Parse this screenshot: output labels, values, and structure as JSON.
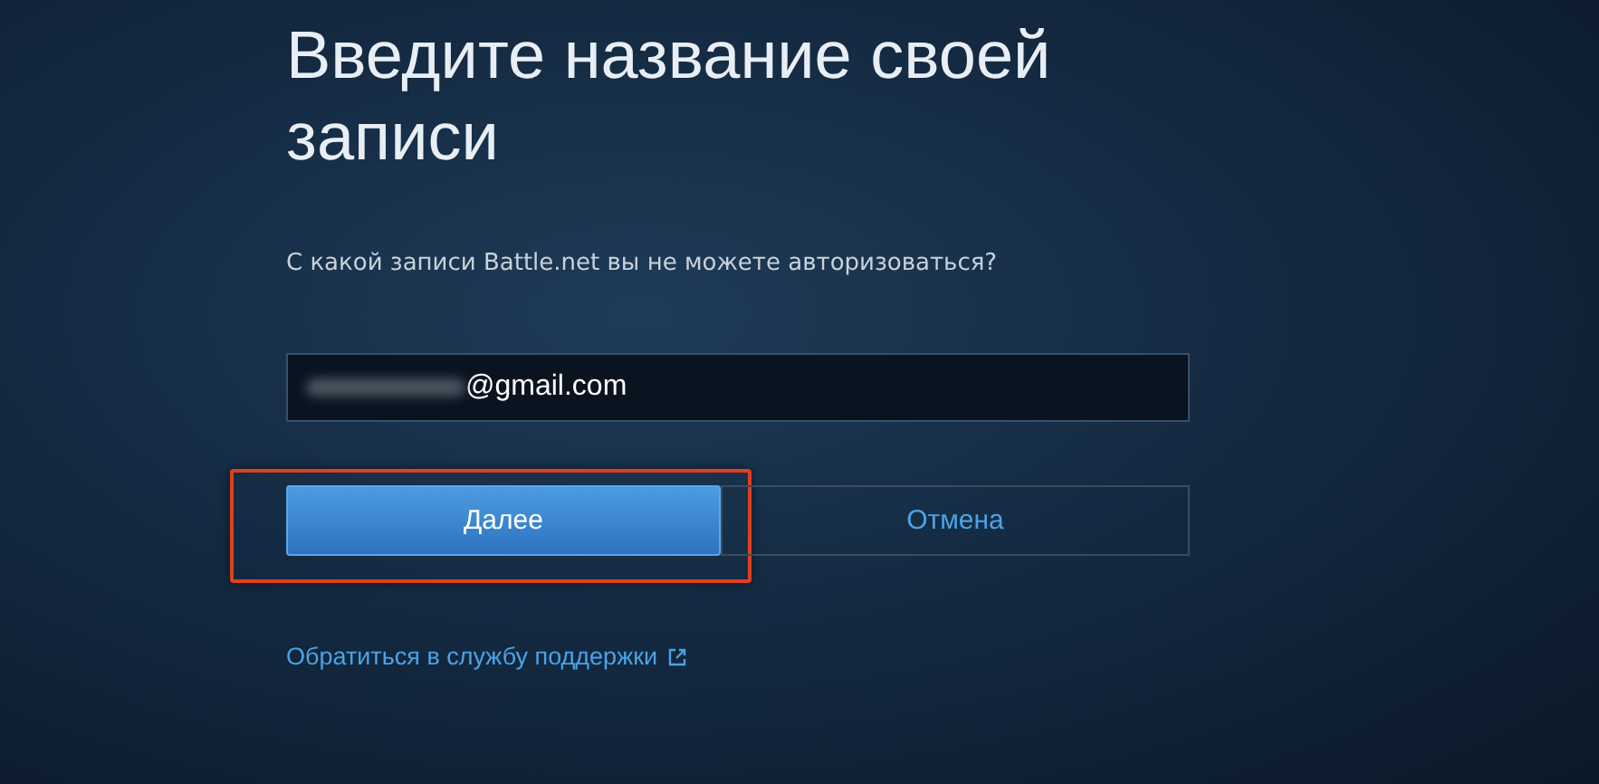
{
  "heading": "Введите название своей записи",
  "prompt": "С какой записи Battle.net вы не можете авторизоваться?",
  "account_field": {
    "value": "@gmail.com",
    "redacted": true
  },
  "buttons": [
    {
      "label": "Далее",
      "kind": "primary",
      "highlighted": true
    },
    {
      "label": "Отмена",
      "kind": "secondary",
      "highlighted": false
    }
  ],
  "support_link": {
    "label": "Обратиться в службу поддержки"
  }
}
